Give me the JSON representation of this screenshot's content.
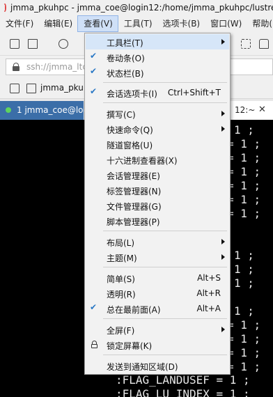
{
  "window": {
    "title": "jmma_pkuhpc - jmma_coe@login12:/home/jmma_pkuhpc/lustre"
  },
  "menubar": [
    "文件(F)",
    "编辑(E)",
    "查看(V)",
    "工具(T)",
    "选项卡(B)",
    "窗口(W)",
    "帮助("
  ],
  "address": {
    "value": "ssh://jmma_ltc"
  },
  "linkbar": {
    "label": "jmma_pkul"
  },
  "tabs": {
    "active": "1 jmma_coe@log",
    "second": "12:~",
    "close": "✕"
  },
  "terminal": {
    "lines": [
      "1 ;",
      "= 1 ;",
      "= 1 ;",
      "= 1 ;",
      "= 1 ;",
      "= 1 ;",
      "= 1 ;",
      "1 ;",
      "1 ;",
      "1 ;",
      "1 ;",
      "= 1 ;",
      "= 1 ;",
      "= 1 ;",
      "= 1 ;",
      ":FLAG_LANDUSEF = 1 ;",
      ":FLAG_LU_INDEX = 1 ;"
    ]
  },
  "view_menu": {
    "items": {
      "toolbar": {
        "label": "工具栏(T)"
      },
      "scrollbar": {
        "label": "卷动条(O)"
      },
      "statusbar": {
        "label": "状态栏(B)"
      },
      "session_tabs": {
        "label": "会话选项卡(I)",
        "shortcut": "Ctrl+Shift+T"
      },
      "compose": {
        "label": "撰写(C)"
      },
      "quick_commands": {
        "label": "快速命令(Q)"
      },
      "tunnel_pane": {
        "label": "隧道窗格(U)"
      },
      "hex_viewer": {
        "label": "十六进制查看器(X)"
      },
      "session_manager": {
        "label": "会话管理器(E)"
      },
      "tab_manager": {
        "label": "标签管理器(N)"
      },
      "file_manager": {
        "label": "文件管理器(G)"
      },
      "script_manager": {
        "label": "脚本管理器(P)"
      },
      "layout": {
        "label": "布局(L)"
      },
      "theme": {
        "label": "主题(M)"
      },
      "simple": {
        "label": "简单(S)",
        "shortcut": "Alt+S"
      },
      "transparent": {
        "label": "透明(R)",
        "shortcut": "Alt+R"
      },
      "always_on_top": {
        "label": "总在最前面(A)",
        "shortcut": "Alt+A"
      },
      "fullscreen": {
        "label": "全屏(F)"
      },
      "lock_screen": {
        "label": "锁定屏幕(K)"
      },
      "send_to_tray": {
        "label": "发送到通知区域(D)"
      }
    },
    "check_glyph": "✔"
  },
  "colors": {
    "accent": "#2a78c5",
    "tab_active": "#3b6ea8",
    "terminal_bg": "#000000"
  }
}
